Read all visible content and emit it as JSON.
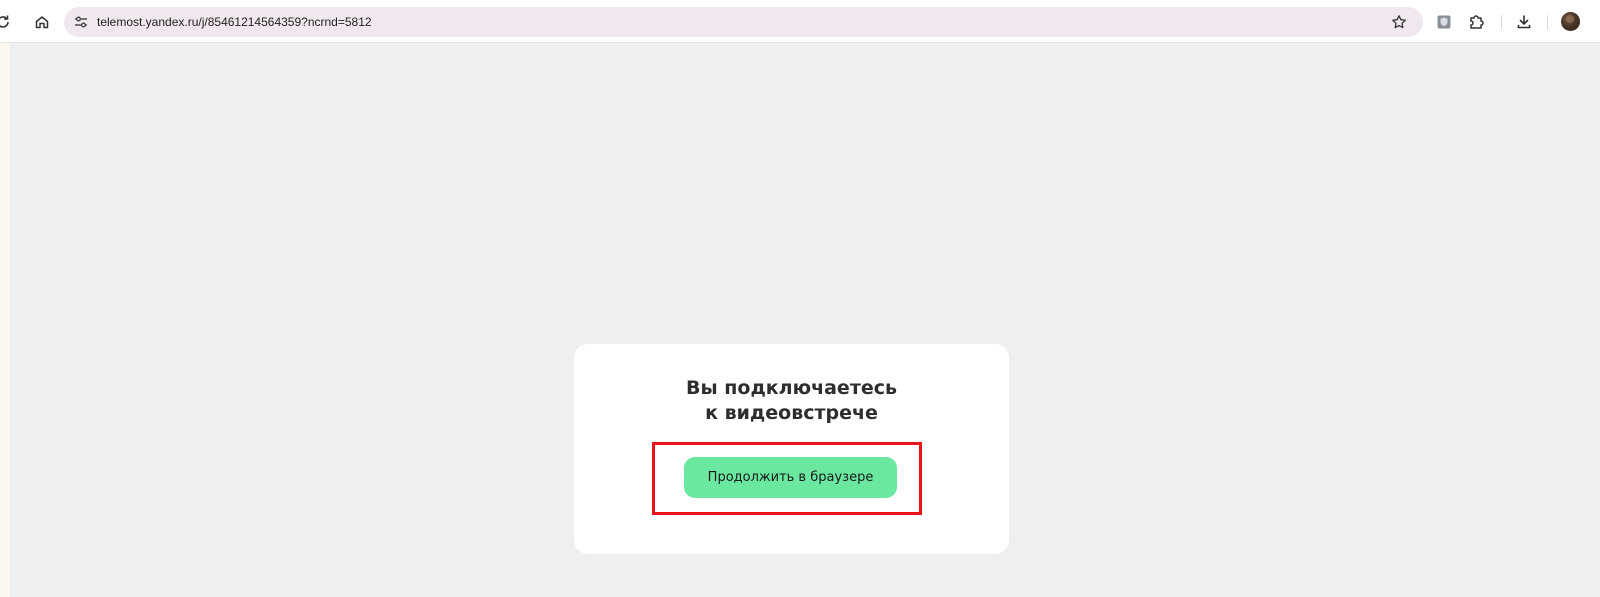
{
  "browser": {
    "url": "telemost.yandex.ru/j/85461214564359?ncrnd=5812",
    "icons": {
      "reload": "reload-icon",
      "home": "home-icon",
      "site_info": "tune-icon",
      "bookmark": "star-icon",
      "extension_shield": "shield-icon",
      "extensions": "puzzle-icon",
      "downloads": "download-icon",
      "profile": "avatar"
    }
  },
  "page": {
    "background": "#eeeff1",
    "card": {
      "title_line1": "Вы подключаетесь",
      "title_line2": "к видеовстрече",
      "continue_button": "Продолжить в браузере",
      "button_color": "#6ae8a0",
      "highlight_color": "#e8141a"
    }
  }
}
